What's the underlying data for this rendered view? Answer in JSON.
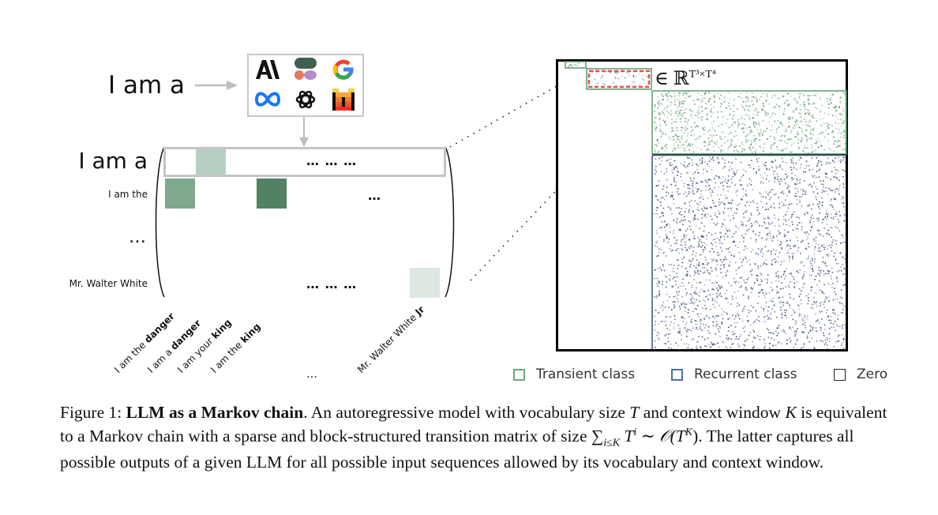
{
  "figure": {
    "prompt": "I am a",
    "logos": [
      {
        "name": "anthropic-logo",
        "glyph": "A\\",
        "color": "#111111"
      },
      {
        "name": "cohere-logo",
        "glyph": "",
        "color": "#3f5f4f"
      },
      {
        "name": "google-logo",
        "glyph": "G",
        "color": "#4285f4"
      },
      {
        "name": "meta-logo",
        "glyph": "∞",
        "color": "#1877f2"
      },
      {
        "name": "openai-logo",
        "glyph": "✿",
        "color": "#111111"
      },
      {
        "name": "mistral-logo",
        "glyph": "M",
        "color": "#f5a623"
      }
    ],
    "matrix": {
      "row_labels": [
        "I am a",
        "I am the",
        "…",
        "Mr. Walter White"
      ],
      "row_dots": [
        "… … …",
        "…",
        "",
        "… … …"
      ],
      "column_labels": [
        {
          "prefix": "I am the ",
          "bold": "danger"
        },
        {
          "prefix": "I am a ",
          "bold": "danger"
        },
        {
          "prefix": "I am your ",
          "bold": "king"
        },
        {
          "prefix": "I am the ",
          "bold": "king"
        },
        {
          "prefix": "Mr. Walter White ",
          "bold": "Jr"
        }
      ],
      "column_ellipsis": "…",
      "cells": [
        {
          "row": 0,
          "col": 1,
          "color": "#b7cfc2"
        },
        {
          "row": 1,
          "col": 0,
          "color": "#7fa88f"
        },
        {
          "row": 1,
          "col": 3,
          "color": "#518261"
        },
        {
          "row": 3,
          "col": 8,
          "color": "#dce8e0"
        }
      ]
    },
    "transition_matrix": {
      "membership_label": "∈ ℝ",
      "membership_exponent": "T³×T⁴",
      "transient_color": "#5a9a6e",
      "recurrent_color": "#3a4a7a",
      "highlight_color": "#e05050"
    },
    "legend": [
      {
        "label": "Transient class",
        "color": "#6aaa7c"
      },
      {
        "label": "Recurrent class",
        "color": "#4a6ea8"
      },
      {
        "label": "Zero",
        "color": "#222222"
      }
    ]
  },
  "caption": {
    "prefix": "Figure 1: ",
    "title": "LLM as a Markov chain",
    "body_1": ". An autoregressive model with vocabulary size ",
    "var_T": "T",
    "body_2": " and context window ",
    "var_K": "K",
    "body_3": " is equivalent to a Markov chain with a sparse and block-structured transition matrix of size ",
    "formula": "∑",
    "formula_sub": "i≤K",
    "formula_rest": " T",
    "formula_sup": "i",
    "formula_tail": " ∼ 𝒪(T",
    "formula_sup2": "K",
    "formula_end": ")",
    "body_4": ". The latter captures all possible outputs of a given LLM for all possible input sequences allowed by its vocabulary and context window."
  }
}
